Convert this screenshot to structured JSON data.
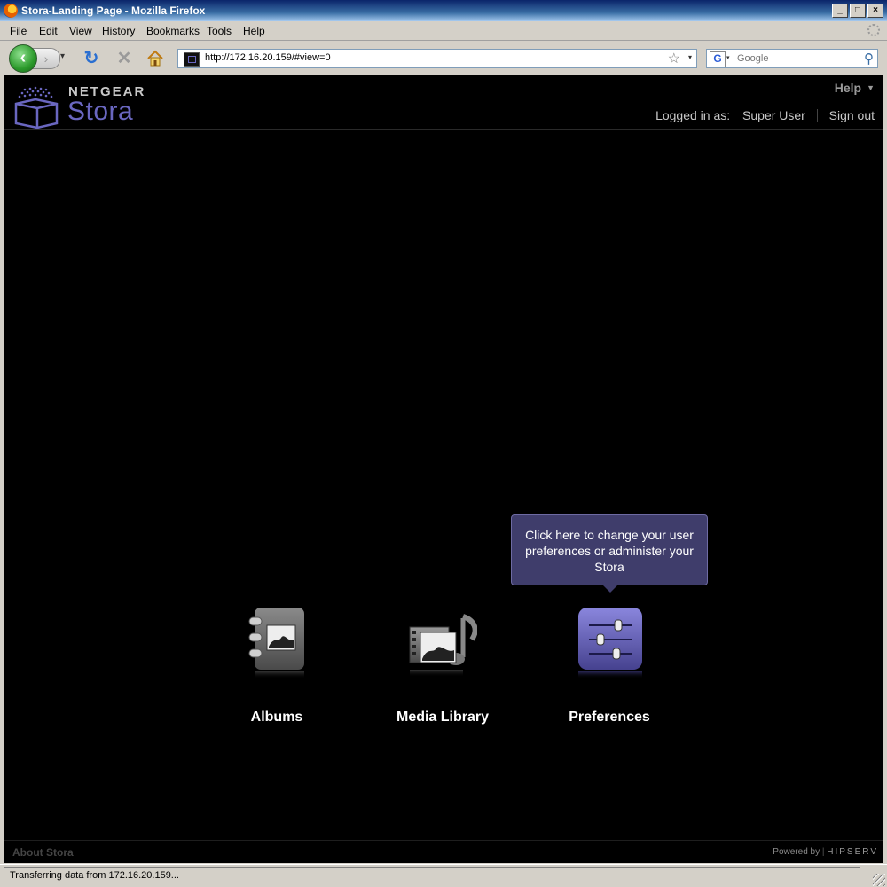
{
  "window": {
    "title": "Stora-Landing Page - Mozilla Firefox",
    "controls": [
      "_",
      "□",
      "×"
    ]
  },
  "menu": {
    "items": [
      "File",
      "Edit",
      "View",
      "History",
      "Bookmarks",
      "Tools",
      "Help"
    ]
  },
  "toolbar": {
    "back_glyph": "‹",
    "forward_glyph": "›",
    "dropdown_glyph": "▾",
    "reload_glyph": "↻",
    "stop_glyph": "✕",
    "url": "http://172.16.20.159/#view=0",
    "star_glyph": "☆",
    "search_engine_glyph": "G",
    "search_placeholder": "Google",
    "search_glyph": "⚲"
  },
  "header": {
    "logo_netgear": "NETGEAR",
    "logo_stora": "Stora",
    "help_label": "Help",
    "help_caret": "▼",
    "logged_in_label": "Logged in as:",
    "user_name": "Super User",
    "sign_out_label": "Sign out"
  },
  "tooltip": {
    "text": "Click here to change your user preferences or administer your Stora"
  },
  "apps": [
    {
      "label": "Albums"
    },
    {
      "label": "Media Library"
    },
    {
      "label": "Preferences"
    }
  ],
  "footer": {
    "about_label": "About Stora",
    "powered_label": "Powered by",
    "powered_brand": "HIPSERV"
  },
  "status": {
    "text": "Transferring data from 172.16.20.159..."
  },
  "colors": {
    "page_background": "#000000",
    "stora_purple": "#6a67c0",
    "tooltip_background": "#3f3d6b"
  }
}
